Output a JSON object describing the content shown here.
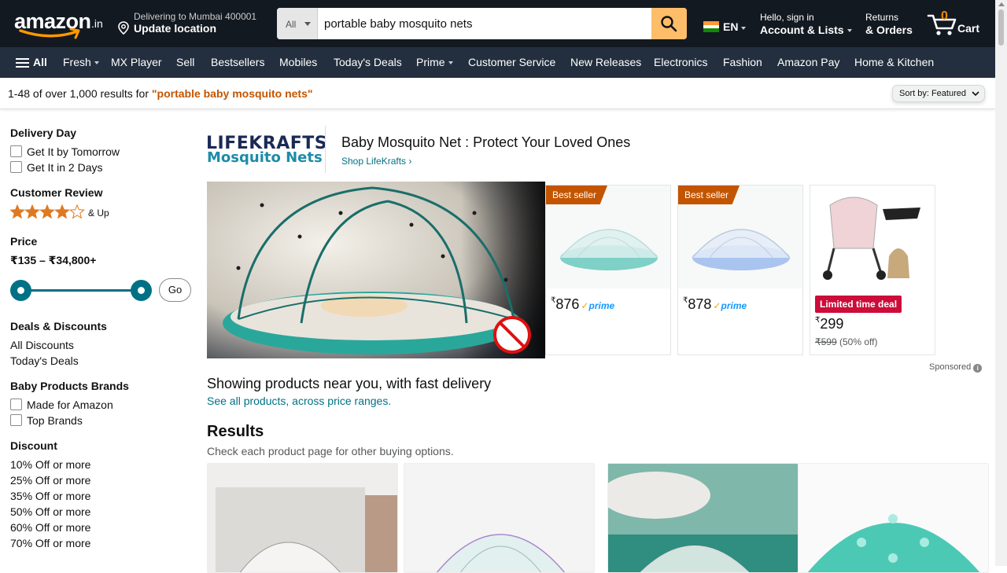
{
  "colors": {
    "nav_top": "#131921",
    "nav_sub": "#232f3e",
    "search_button": "#febd69",
    "accent_link": "#007185",
    "query_highlight": "#c45500",
    "best_seller": "#c45500",
    "limited_deal": "#cc0c39",
    "cart_count": "#f08804"
  },
  "header": {
    "logo": "amazon",
    "logo_suffix": ".in",
    "deliver_line1": "Delivering to Mumbai 400001",
    "deliver_line2": "Update location",
    "search_category": "All",
    "search_value": "portable baby mosquito nets",
    "language": "EN",
    "account_line1": "Hello, sign in",
    "account_line2": "Account & Lists",
    "returns_line1": "Returns",
    "returns_line2": "& Orders",
    "cart_count": "0",
    "cart_label": "Cart"
  },
  "subnav": {
    "all": "All",
    "items": [
      "Fresh",
      "MX Player",
      "Sell",
      "Bestsellers",
      "Mobiles",
      "Today's Deals",
      "Prime",
      "Customer Service",
      "New Releases",
      "Electronics",
      "Fashion",
      "Amazon Pay",
      "Home & Kitchen"
    ]
  },
  "results_bar": {
    "count_text": "1-48 of over 1,000 results for ",
    "query": "\"portable baby mosquito nets\"",
    "sort_label": "Sort by:  Featured"
  },
  "sidebar": {
    "delivery_heading": "Delivery Day",
    "delivery_opts": [
      "Get It by Tomorrow",
      "Get It in 2 Days"
    ],
    "review_heading": "Customer Review",
    "review_rating": 4,
    "review_suffix": "& Up",
    "price_heading": "Price",
    "price_range": "₹135 – ₹34,800+",
    "go_label": "Go",
    "deals_heading": "Deals & Discounts",
    "deals_links": [
      "All Discounts",
      "Today's Deals"
    ],
    "brands_heading": "Baby Products Brands",
    "brands_opts": [
      "Made for Amazon",
      "Top Brands"
    ],
    "discount_heading": "Discount",
    "discount_links": [
      "10% Off or more",
      "25% Off or more",
      "35% Off or more",
      "50% Off or more",
      "60% Off or more",
      "70% Off or more"
    ]
  },
  "sponsored_brand": {
    "logo_line1": "LIFEKRAFTS",
    "logo_line2": "Mosquito Nets",
    "headline": "Baby Mosquito Net : Protect Your Loved Ones",
    "shop_link": "Shop LifeKrafts ›",
    "cards": [
      {
        "badge": "Best seller",
        "price_symbol": "₹",
        "price": "876",
        "prime": "prime"
      },
      {
        "badge": "Best seller",
        "price_symbol": "₹",
        "price": "878",
        "prime": "prime"
      },
      {
        "deal": "Limited time deal",
        "price_symbol": "₹",
        "price": "299",
        "was": "₹599",
        "off": " (50% off)"
      }
    ],
    "sponsored_label": "Sponsored"
  },
  "near_you": {
    "heading": "Showing products near you, with fast delivery",
    "link": "See all products, across price ranges."
  },
  "results": {
    "heading": "Results",
    "subheading": "Check each product page for other buying options."
  }
}
